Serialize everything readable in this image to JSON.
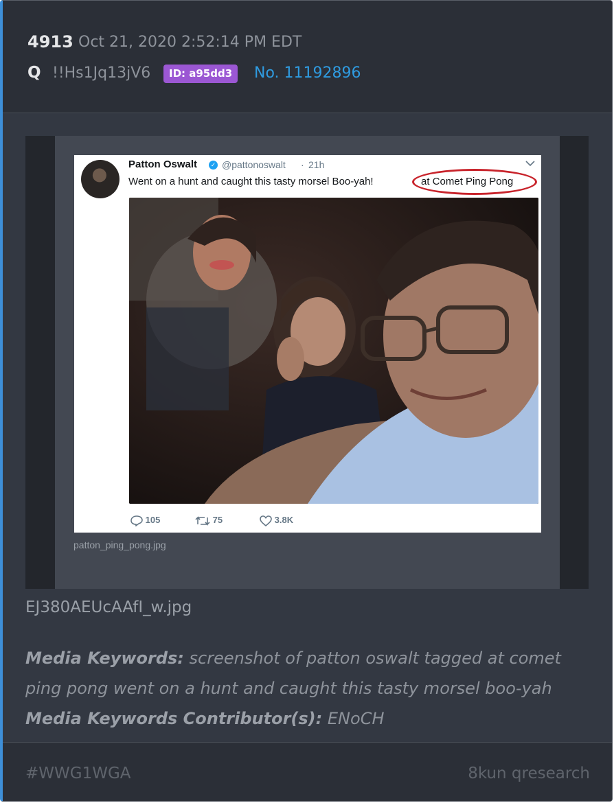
{
  "post": {
    "number": "4913",
    "date": "Oct 21, 2020 2:52:14 PM EDT",
    "author": "Q",
    "tripcode": "!!Hs1Jq13jV6",
    "id_badge": "ID: a95dd3",
    "post_no": "No. 11192896"
  },
  "media": {
    "tweet": {
      "name": "Patton Oswalt",
      "handle": "@pattonoswalt",
      "dot": "·",
      "time": "21h",
      "text": "Went on a hunt and caught this tasty morsel  Boo-yah!",
      "location": "at Comet Ping Pong",
      "replies": "105",
      "retweets": "75",
      "likes": "3.8K"
    },
    "embedded_filename": "patton_ping_pong.jpg",
    "filename": "EJ380AEUcAAfI_w.jpg"
  },
  "keywords": {
    "label": "Media Keywords:",
    "text": "screenshot of patton oswalt tagged at comet ping pong went on a hunt and caught this tasty morsel boo-yah",
    "contributor_label": "Media Keywords Contributor(s):",
    "contributor": "ENoCH"
  },
  "footer": {
    "hashtag": "#WWG1WGA",
    "source": "8kun qresearch"
  },
  "colors": {
    "accent": "#3e8fd8",
    "id_badge": "#9b57d3",
    "link": "#2f9be0",
    "circle": "#c8232b"
  }
}
